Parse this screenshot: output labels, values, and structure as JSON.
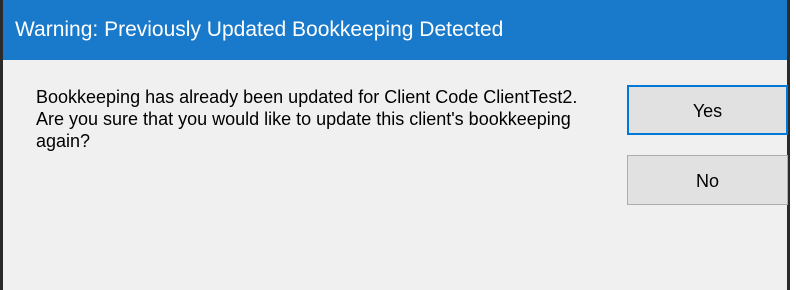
{
  "window": {
    "title": "Warning: Previously Updated Bookkeeping Detected"
  },
  "message": {
    "text": "Bookkeeping has already been updated for Client Code ClientTest2. Are you sure that you would like to update this client's bookkeeping again?"
  },
  "buttons": {
    "yes_label": "Yes",
    "no_label": "No"
  },
  "colors": {
    "titlebar": "#1979ca",
    "dialog_background": "#f0f0f0",
    "focus_border": "#0078d7"
  }
}
